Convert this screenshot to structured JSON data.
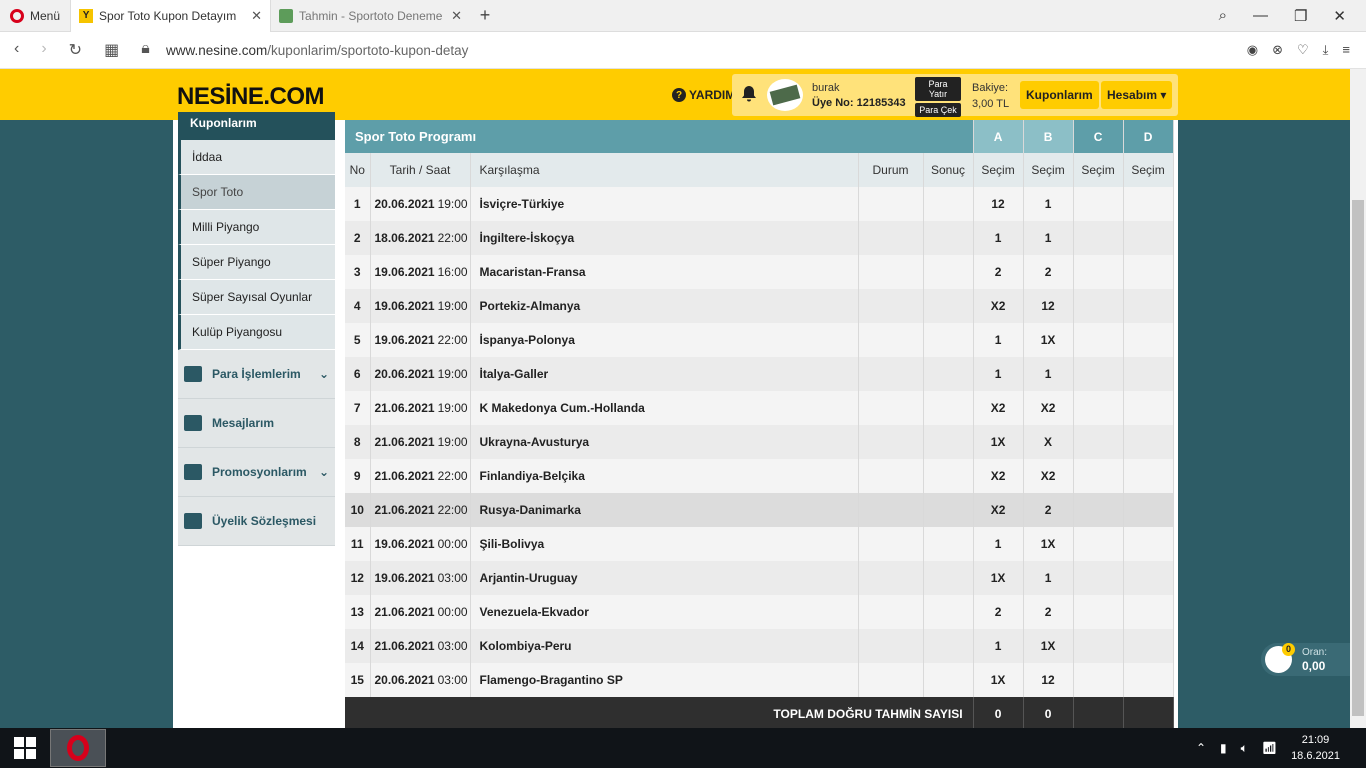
{
  "browser": {
    "menu_label": "Menü",
    "tabs": [
      {
        "title": "Spor Toto Kupon Detayım",
        "active": true
      },
      {
        "title": "Tahmin - Sportoto Deneme",
        "active": false
      }
    ],
    "url_host": "www.nesine.com",
    "url_path": "/kuponlarim/sportoto-kupon-detay"
  },
  "header": {
    "logo": "NESİNE.COM",
    "help_label": "YARDIM",
    "username": "burak",
    "member_no": "Üye No: 12185343",
    "deposit_label": "Para Yatır",
    "withdraw_label": "Para Çek",
    "balance_label": "Bakiye:",
    "balance_value": "3,00 TL",
    "coupons_label": "Kuponlarım",
    "account_label": "Hesabım"
  },
  "sidebar": {
    "section_title": "Kuponlarım",
    "sub_items": [
      "İddaa",
      "Spor Toto",
      "Milli Piyango",
      "Süper Piyango",
      "Süper Sayısal Oyunlar",
      "Kulüp Piyangosu"
    ],
    "active_sub": 1,
    "main_items": [
      {
        "label": "Para İşlemlerim",
        "icon": "wallet-icon",
        "expandable": true
      },
      {
        "label": "Mesajlarım",
        "icon": "envelope-icon",
        "expandable": false
      },
      {
        "label": "Promosyonlarım",
        "icon": "ticket-icon",
        "expandable": true
      },
      {
        "label": "Üyelik Sözleşmesi",
        "icon": "document-icon",
        "expandable": false
      }
    ]
  },
  "table": {
    "title": "Spor Toto Programı",
    "columns_letters": [
      "A",
      "B",
      "C",
      "D"
    ],
    "headers": {
      "no": "No",
      "date": "Tarih / Saat",
      "match": "Karşılaşma",
      "status": "Durum",
      "result": "Sonuç",
      "choice": "Seçim"
    },
    "rows": [
      {
        "no": "1",
        "date": "20.06.2021",
        "time": "19:00",
        "match": "İsviçre-Türkiye",
        "a": "12",
        "b": "1"
      },
      {
        "no": "2",
        "date": "18.06.2021",
        "time": "22:00",
        "match": "İngiltere-İskoçya",
        "a": "1",
        "b": "1"
      },
      {
        "no": "3",
        "date": "19.06.2021",
        "time": "16:00",
        "match": "Macaristan-Fransa",
        "a": "2",
        "b": "2"
      },
      {
        "no": "4",
        "date": "19.06.2021",
        "time": "19:00",
        "match": "Portekiz-Almanya",
        "a": "X2",
        "b": "12"
      },
      {
        "no": "5",
        "date": "19.06.2021",
        "time": "22:00",
        "match": "İspanya-Polonya",
        "a": "1",
        "b": "1X"
      },
      {
        "no": "6",
        "date": "20.06.2021",
        "time": "19:00",
        "match": "İtalya-Galler",
        "a": "1",
        "b": "1"
      },
      {
        "no": "7",
        "date": "21.06.2021",
        "time": "19:00",
        "match": "K Makedonya Cum.-Hollanda",
        "a": "X2",
        "b": "X2"
      },
      {
        "no": "8",
        "date": "21.06.2021",
        "time": "19:00",
        "match": "Ukrayna-Avusturya",
        "a": "1X",
        "b": "X"
      },
      {
        "no": "9",
        "date": "21.06.2021",
        "time": "22:00",
        "match": "Finlandiya-Belçika",
        "a": "X2",
        "b": "X2"
      },
      {
        "no": "10",
        "date": "21.06.2021",
        "time": "22:00",
        "match": "Rusya-Danimarka",
        "a": "X2",
        "b": "2"
      },
      {
        "no": "11",
        "date": "19.06.2021",
        "time": "00:00",
        "match": "Şili-Bolivya",
        "a": "1",
        "b": "1X"
      },
      {
        "no": "12",
        "date": "19.06.2021",
        "time": "03:00",
        "match": "Arjantin-Uruguay",
        "a": "1X",
        "b": "1"
      },
      {
        "no": "13",
        "date": "21.06.2021",
        "time": "00:00",
        "match": "Venezuela-Ekvador",
        "a": "2",
        "b": "2"
      },
      {
        "no": "14",
        "date": "21.06.2021",
        "time": "03:00",
        "match": "Kolombiya-Peru",
        "a": "1",
        "b": "1X"
      },
      {
        "no": "15",
        "date": "20.06.2021",
        "time": "03:00",
        "match": "Flamengo-Bragantino SP",
        "a": "1X",
        "b": "12"
      }
    ],
    "highlight_row": 9,
    "footer_label": "TOPLAM DOĞRU TAHMİN SAYISI",
    "footer_a": "0",
    "footer_b": "0"
  },
  "oran": {
    "label": "Oran:",
    "value": "0,00",
    "count": "0"
  },
  "taskbar": {
    "time": "21:09",
    "date": "18.6.2021"
  },
  "colors": {
    "brand_yellow": "#ffcc00",
    "teal": "#5e9ea9",
    "dark_teal": "#24515b"
  }
}
